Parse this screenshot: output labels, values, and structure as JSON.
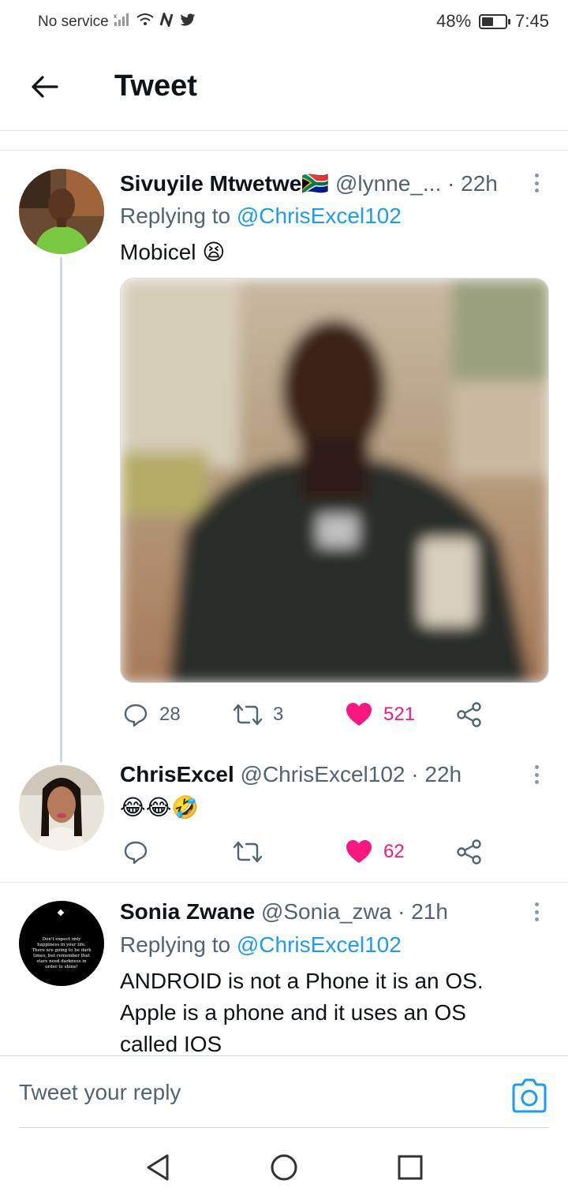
{
  "status_bar": {
    "carrier": "No service",
    "battery": "48%",
    "battery_level": 0.48,
    "time": "7:45",
    "icons": [
      "signal-icon",
      "wifi-icon",
      "nfc-icon",
      "twitter-icon"
    ]
  },
  "header": {
    "title": "Tweet"
  },
  "tweets": [
    {
      "name": "Sivuyile Mtwetwe",
      "flag_emoji": "🇿🇦",
      "handle": "@lynne_...",
      "time": "· 22h",
      "replying_prefix": "Replying to ",
      "replying_to": "@ChrisExcel102",
      "text": "Mobicel",
      "text_emoji": "😫",
      "replies": "28",
      "retweets": "3",
      "likes": "521"
    },
    {
      "name": "ChrisExcel",
      "handle": "@ChrisExcel102",
      "time": "· 22h",
      "text": "😂😂🤣",
      "likes": "62"
    },
    {
      "name": "Sonia Zwane",
      "handle": "@Sonia_zwa",
      "time": "· 21h",
      "replying_prefix": "Replying to ",
      "replying_to": "@ChrisExcel102",
      "text_line1": "ANDROID is not a Phone it is an OS.",
      "text_line2": "Apple is a phone and it uses an OS",
      "text_line3": "called IOS",
      "avatar_text": "Don't expect only happiness in your life. There are going to be dark times, but remember that stars need darkness in order to shine!"
    }
  ],
  "composer": {
    "placeholder": "Tweet your reply"
  },
  "colors": {
    "accent": "#1d9bf0",
    "like": "#f91880",
    "muted": "#536471"
  }
}
